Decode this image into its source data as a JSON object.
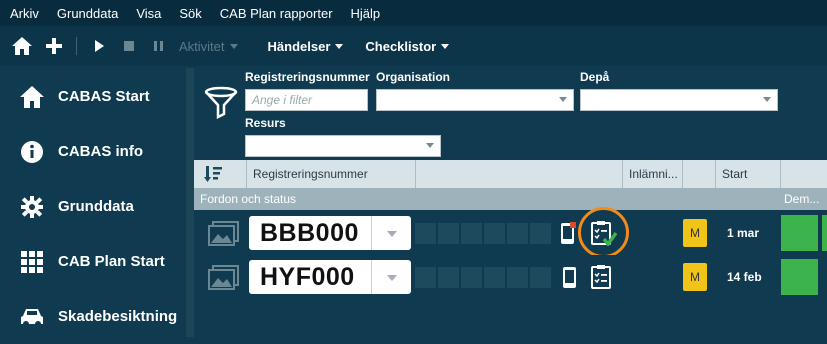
{
  "menu": [
    "Arkiv",
    "Grunddata",
    "Visa",
    "Sök",
    "CAB Plan rapporter",
    "Hjälp"
  ],
  "toolbar": {
    "home_icon": "home-icon",
    "add_icon": "plus-icon",
    "play_icon": "play-icon",
    "stop_icon": "stop-icon",
    "pause_icon": "pause-icon",
    "aktivitet": "Aktivitet",
    "handelser": "Händelser",
    "checklistor": "Checklistor"
  },
  "sidebar": [
    {
      "label": "CABAS Start",
      "icon": "home-icon"
    },
    {
      "label": "CABAS info",
      "icon": "info-icon"
    },
    {
      "label": "Grunddata",
      "icon": "gear-icon"
    },
    {
      "label": "CAB Plan Start",
      "icon": "grid-icon"
    },
    {
      "label": "Skadebesiktning",
      "icon": "car-icon"
    }
  ],
  "filters": {
    "registreringsnummer_label": "Registreringsnummer",
    "registreringsnummer_placeholder": "Ange i filter",
    "organisation_label": "Organisation",
    "depa_label": "Depå",
    "resurs_label": "Resurs"
  },
  "table": {
    "headers": {
      "reg": "Registreringsnummer",
      "inlamning": "Inlämni...",
      "start": "Start"
    },
    "group": {
      "label": "Fordon och status",
      "right": "Dem..."
    },
    "rows": [
      {
        "plate": "BBB000",
        "badge": "M",
        "date": "1 mar",
        "checklist_done": true
      },
      {
        "plate": "HYF000",
        "badge": "M",
        "date": "14 feb",
        "checklist_done": false
      }
    ]
  },
  "colors": {
    "highlight_ring": "#f08c1e",
    "green": "#3cb44b",
    "badge": "#f0c419"
  }
}
